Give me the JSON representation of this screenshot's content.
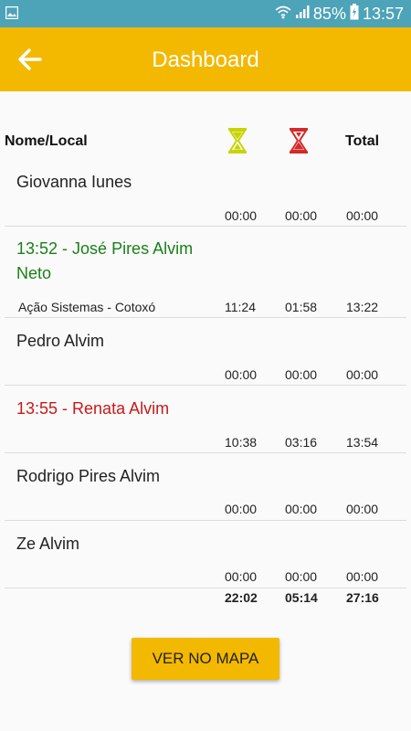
{
  "status_bar": {
    "battery": "85%",
    "time": "13:57"
  },
  "app_bar": {
    "title": "Dashboard"
  },
  "table": {
    "header_name": "Nome/Local",
    "header_total": "Total",
    "rows": [
      {
        "name": "Giovanna Iunes",
        "place": "",
        "t1": "00:00",
        "t2": "00:00",
        "total": "00:00"
      },
      {
        "name_line1": "13:52 - José Pires Alvim",
        "name_line2": "Neto",
        "place": "Ação Sistemas - Cotoxó",
        "t1": "11:24",
        "t2": "01:58",
        "total": "13:22"
      },
      {
        "name": "Pedro Alvim",
        "place": "",
        "t1": "00:00",
        "t2": "00:00",
        "total": "00:00"
      },
      {
        "name": "13:55 - Renata Alvim",
        "place": "",
        "t1": "10:38",
        "t2": "03:16",
        "total": "13:54"
      },
      {
        "name": "Rodrigo Pires Alvim",
        "place": "",
        "t1": "00:00",
        "t2": "00:00",
        "total": "00:00"
      },
      {
        "name": "Ze Alvim",
        "place": "",
        "t1": "00:00",
        "t2": "00:00",
        "total": "00:00"
      }
    ],
    "totals": {
      "t1": "22:02",
      "t2": "05:14",
      "total": "27:16"
    }
  },
  "map_button_label": "VER NO MAPA",
  "colors": {
    "accent": "#f3b800",
    "status_bar": "#4da3b8",
    "active_green": "#1a7f1a",
    "active_red": "#c81919",
    "hourglass_green": "#c8d400",
    "hourglass_red": "#d42a2a"
  },
  "icons": {
    "back": "arrow-left-icon",
    "hourglass_green": "hourglass-icon",
    "hourglass_red": "hourglass-icon"
  }
}
